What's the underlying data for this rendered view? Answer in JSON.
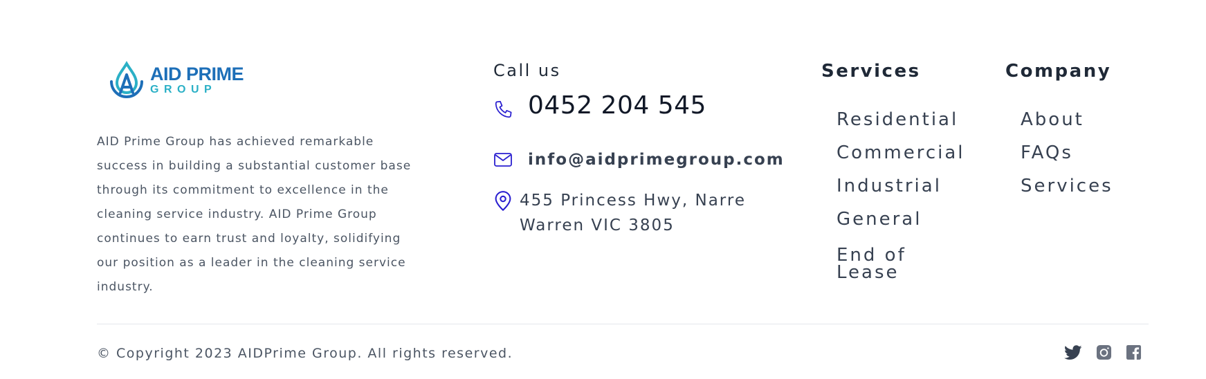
{
  "brand": {
    "name": "AID PRIME",
    "subtitle": "GROUP",
    "colors": {
      "primary": "#1d6fb8",
      "secondary": "#2bb0c6",
      "icon": "#2a1fd0"
    }
  },
  "about_text": "AID Prime Group has achieved remarkable success in building a substantial customer base through its commitment to excellence in the cleaning service industry. AID Prime Group continues to earn trust and loyalty, solidifying our position as a leader in the cleaning service industry.",
  "contact": {
    "heading": "Call us",
    "phone": "0452 204 545",
    "phone_icon": "phone-icon",
    "email": "info@aidprimegroup.com",
    "email_icon": "mail-icon",
    "address": "455 Princess Hwy, Narre Warren VIC 3805",
    "address_icon": "map-pin-icon"
  },
  "services": {
    "heading": "Services",
    "items": [
      "Residential",
      "Commercial",
      "Industrial",
      "General",
      "End of Lease"
    ]
  },
  "company": {
    "heading": "Company",
    "items": [
      "About",
      "FAQs",
      "Services"
    ]
  },
  "footer": {
    "copyright": "© Copyright 2023 AIDPrime Group. All rights reserved.",
    "socials": [
      "twitter-icon",
      "instagram-icon",
      "facebook-icon"
    ]
  }
}
